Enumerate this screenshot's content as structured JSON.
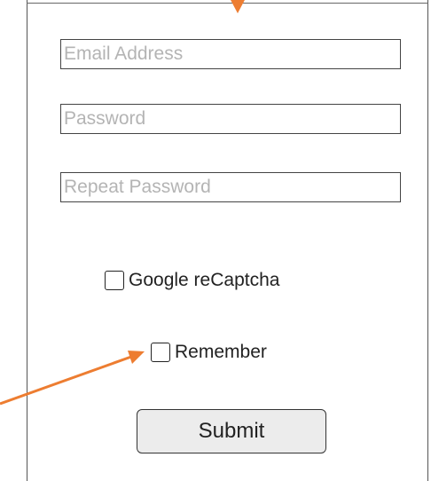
{
  "form": {
    "email": {
      "placeholder": "Email Address",
      "value": ""
    },
    "password": {
      "placeholder": "Password",
      "value": ""
    },
    "repeat_password": {
      "placeholder": "Repeat Password",
      "value": ""
    },
    "recaptcha": {
      "label": "Google reCaptcha",
      "checked": false
    },
    "remember": {
      "label": "Remember",
      "checked": false
    },
    "submit_label": "Submit"
  },
  "annotation": {
    "arrow_color": "#ED7D31"
  },
  "colors": {
    "border": "#444444",
    "placeholder": "#b4b4b4",
    "button_bg": "#ececec"
  }
}
